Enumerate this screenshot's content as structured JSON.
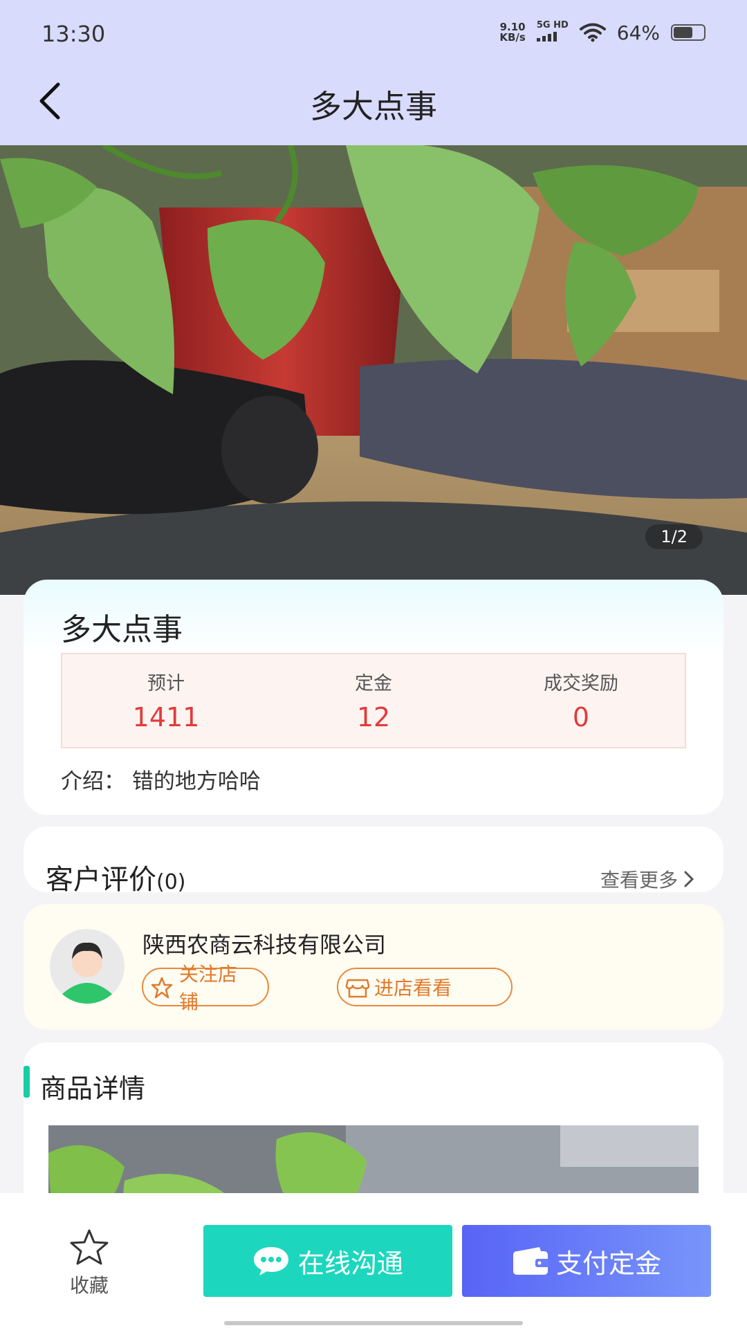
{
  "status_bar": {
    "time": "13:30",
    "net_speed": "9.10",
    "net_unit": "KB/s",
    "network": "5G HD",
    "battery": "64%",
    "battery_level": 0.64
  },
  "header": {
    "title": "多大点事",
    "back_icon": "chevron-left-icon"
  },
  "gallery": {
    "pager": "1/2"
  },
  "product": {
    "name": "多大点事",
    "stats": [
      {
        "label": "预计",
        "value": "1411"
      },
      {
        "label": "定金",
        "value": "12"
      },
      {
        "label": "成交奖励",
        "value": "0"
      }
    ],
    "intro": "介绍：  错的地方哈哈"
  },
  "reviews": {
    "title": "客户评价",
    "count": "(0)",
    "more": "查看更多"
  },
  "shop": {
    "name": "陕西农商云科技有限公司",
    "follow_label": "关注店铺",
    "enter_label": "进店看看"
  },
  "details": {
    "title": "商品详情"
  },
  "bottom_bar": {
    "favorite_label": "收藏",
    "chat_label": "在线沟通",
    "pay_label": "支付定金"
  },
  "colors": {
    "header_bg": "#d8dbfb",
    "price_red": "#e23a3a",
    "accent_teal": "#1cd7be",
    "accent_blue": "#5864f6",
    "shop_orange": "#e07a2c"
  }
}
